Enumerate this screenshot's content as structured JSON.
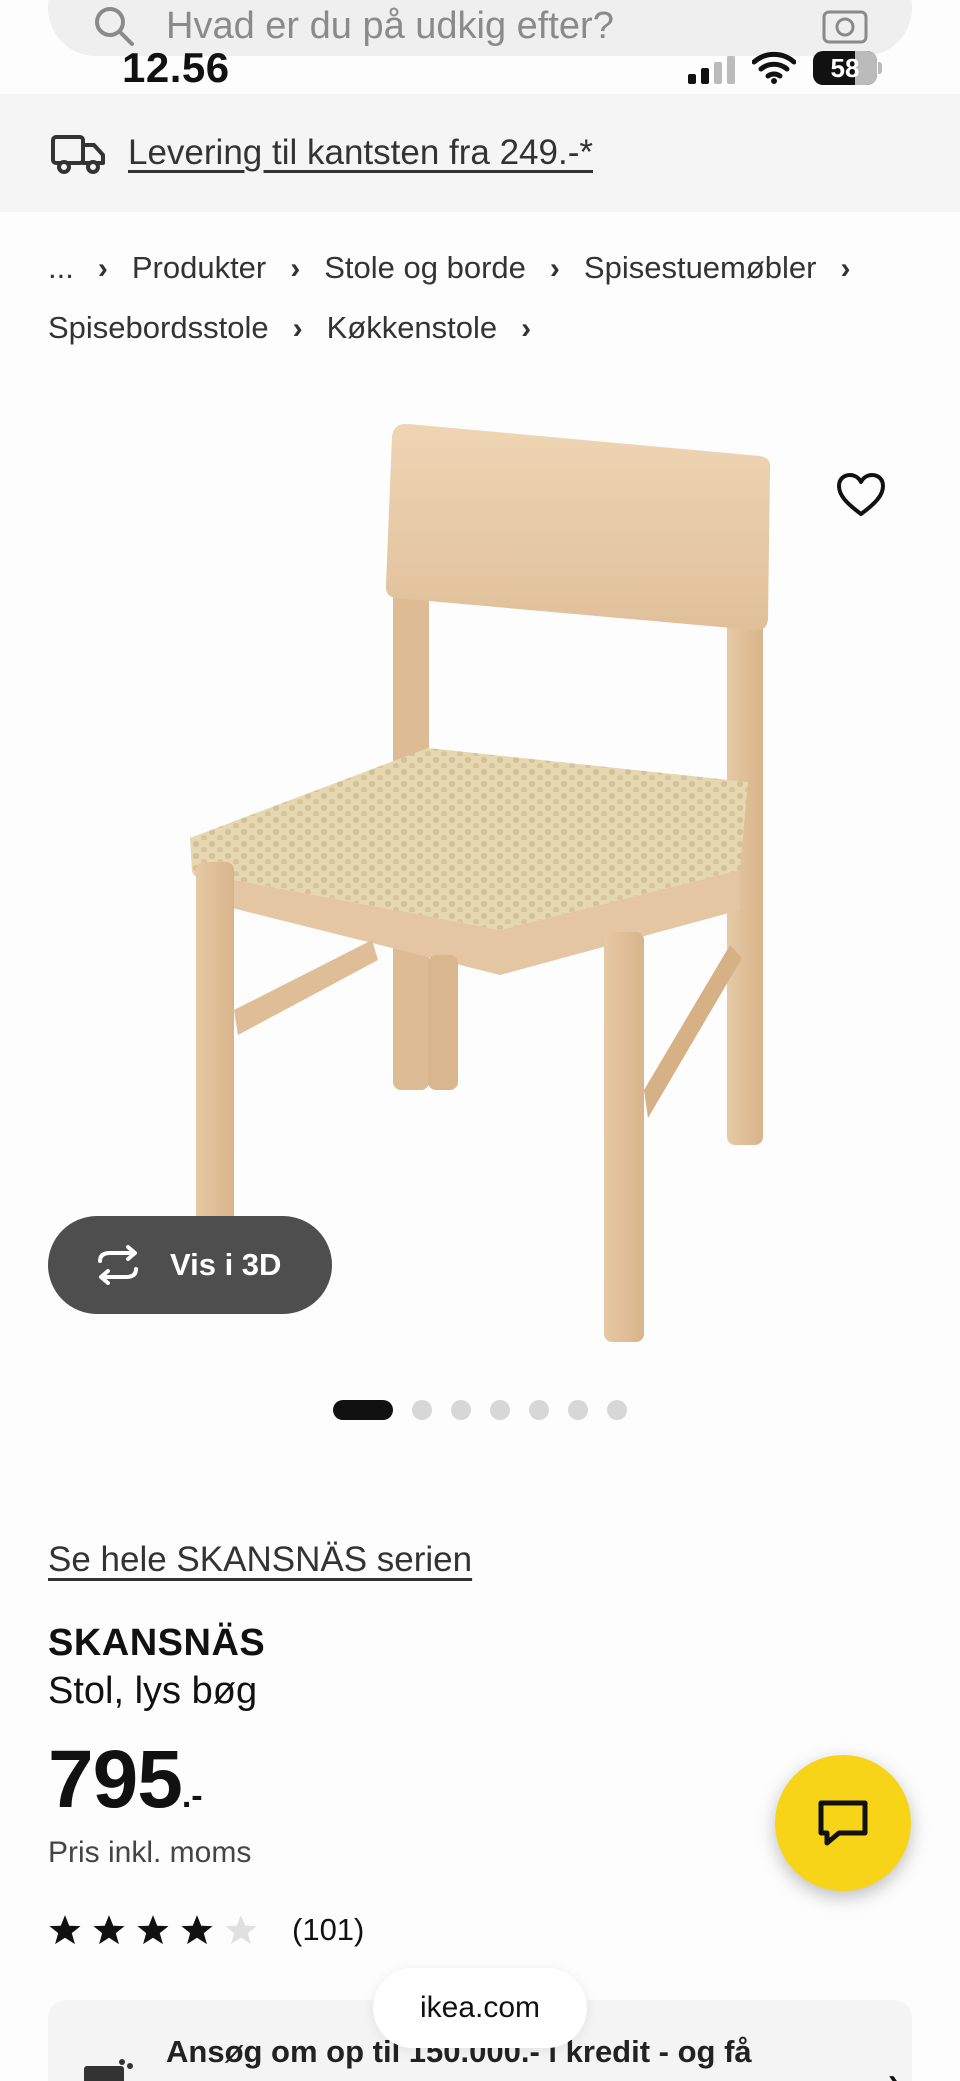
{
  "search": {
    "placeholder": "Hvad er du på udkig efter?"
  },
  "status_bar": {
    "time": "12.56",
    "battery": "58",
    "battery_fraction": 0.58
  },
  "delivery_banner": {
    "text": "Levering til kantsten fra 249.-*"
  },
  "breadcrumb": [
    {
      "label": "..."
    },
    {
      "label": "Produkter"
    },
    {
      "label": "Stole og borde"
    },
    {
      "label": "Spisestuemøbler"
    },
    {
      "label": "Spisebordsstole"
    },
    {
      "label": "Køkkenstole"
    }
  ],
  "gallery": {
    "view_3d_label": "Vis i 3D",
    "slide_count": 7,
    "active_slide": 1
  },
  "product": {
    "series_link": "Se hele SKANSNÄS serien",
    "name": "SKANSNÄS",
    "description": "Stol, lys bøg",
    "price_integer": "795",
    "price_decimal": ".-",
    "vat_note": "Pris inkl. moms",
    "rating_stars": 4,
    "rating_max": 5,
    "review_count": "(101)"
  },
  "credit_banner": {
    "text": "Ansøg om op til 150.000.- i kredit - og få"
  },
  "browser": {
    "url": "ikea.com"
  },
  "colors": {
    "chat_yellow": "#f7d418",
    "dark_button": "#4e4e4e",
    "banner_bg": "#f5f5f5"
  },
  "icons": [
    "search-icon",
    "camera-icon",
    "truck-icon",
    "heart-icon",
    "rotate-3d-icon",
    "chat-icon",
    "credit-icon",
    "chevron-right-icon"
  ]
}
